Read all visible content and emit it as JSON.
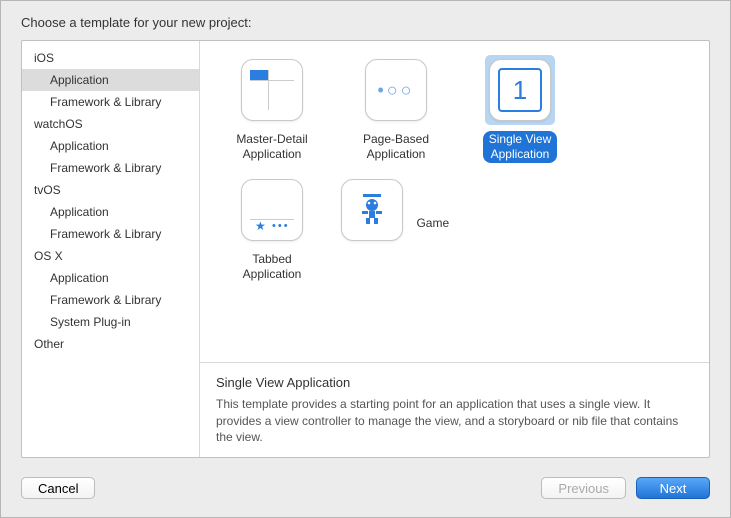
{
  "header": {
    "title": "Choose a template for your new project:"
  },
  "sidebar": {
    "groups": [
      {
        "name": "iOS",
        "items": [
          "Application",
          "Framework & Library"
        ]
      },
      {
        "name": "watchOS",
        "items": [
          "Application",
          "Framework & Library"
        ]
      },
      {
        "name": "tvOS",
        "items": [
          "Application",
          "Framework & Library"
        ]
      },
      {
        "name": "OS X",
        "items": [
          "Application",
          "Framework & Library",
          "System Plug-in"
        ]
      },
      {
        "name": "Other",
        "items": []
      }
    ],
    "selected": "Application"
  },
  "templates": [
    {
      "id": "master-detail",
      "label": "Master-Detail\nApplication",
      "selected": false
    },
    {
      "id": "page-based",
      "label": "Page-Based\nApplication",
      "selected": false
    },
    {
      "id": "single-view",
      "label": "Single View\nApplication",
      "selected": true
    },
    {
      "id": "tabbed",
      "label": "Tabbed\nApplication",
      "selected": false
    },
    {
      "id": "game",
      "label": "Game",
      "selected": false
    }
  ],
  "description": {
    "title": "Single View Application",
    "text": "This template provides a starting point for an application that uses a single view. It provides a view controller to manage the view, and a storyboard or nib file that contains the view."
  },
  "footer": {
    "cancel": "Cancel",
    "previous": "Previous",
    "next": "Next"
  },
  "icons": {
    "single_view_digit": "1"
  }
}
